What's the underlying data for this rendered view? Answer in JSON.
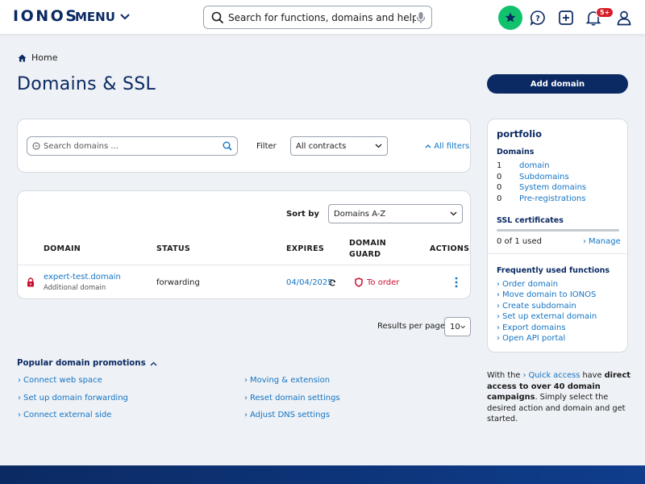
{
  "header": {
    "logo": "IONOS",
    "menu_label": "MENU",
    "search_placeholder": "Search for functions, domains and help",
    "notification_count": "5+"
  },
  "breadcrumb": {
    "home": "Home"
  },
  "page": {
    "title": "Domains & SSL",
    "add_domain": "Add domain"
  },
  "filter_bar": {
    "search_placeholder": "Search domains ...",
    "filter_label": "Filter",
    "contracts_value": "All contracts",
    "all_filters": "All filters"
  },
  "table": {
    "sort_label": "Sort by",
    "sort_value": "Domains A-Z",
    "headers": {
      "domain": "DOMAIN",
      "status": "STATUS",
      "expires": "EXPIRES",
      "guard_1": "DOMAIN",
      "guard_2": "GUARD",
      "actions": "ACTIONS"
    },
    "rows": [
      {
        "domain": "expert-test.domain",
        "type": "Additional domain",
        "status": "forwarding",
        "expires": "04/04/2025",
        "guard": "To order"
      }
    ]
  },
  "pagination": {
    "label": "Results per page",
    "value": "10"
  },
  "portfolio": {
    "title": "portfolio",
    "domains_heading": "Domains",
    "items": [
      {
        "count": "1",
        "label": "domain"
      },
      {
        "count": "0",
        "label": "Subdomains"
      },
      {
        "count": "0",
        "label": "System domains"
      },
      {
        "count": "0",
        "label": "Pre-registrations"
      }
    ],
    "ssl_heading": "SSL certificates",
    "ssl_used": "0 of 1 used",
    "ssl_fraction": 0,
    "manage": "Manage",
    "functions_heading": "Frequently used functions",
    "functions": [
      "Order domain",
      "Move domain to IONOS",
      "Create subdomain",
      "Set up external domain",
      "Export domains",
      "Open API portal"
    ]
  },
  "quick_access": {
    "prefix": "With the",
    "link": "Quick access",
    "middle": "have",
    "bold": "direct access to over 40 domain campaigns",
    "suffix": ". Simply select the desired action and domain and get started."
  },
  "promotions": {
    "title": "Popular domain promotions",
    "left": [
      "Connect web space",
      "Set up domain forwarding",
      "Connect external side"
    ],
    "right": [
      "Moving & extension",
      "Reset domain settings",
      "Adjust DNS settings"
    ]
  },
  "colors": {
    "brand": "#0b2a63",
    "link": "#1474c4",
    "success": "#11c26d",
    "danger": "#c8102e"
  }
}
